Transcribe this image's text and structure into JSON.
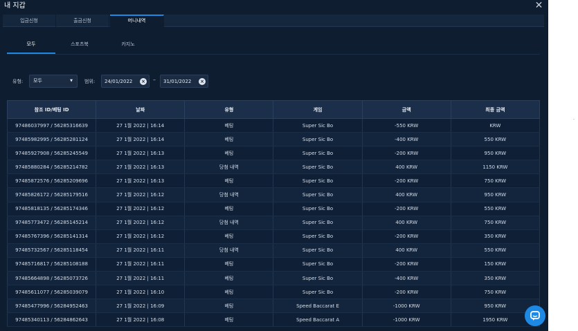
{
  "window": {
    "title": "내 지갑"
  },
  "tabs": [
    "입금신청",
    "출금신청",
    "머니내역"
  ],
  "subtabs": [
    "모두",
    "스포츠북",
    "카지노"
  ],
  "filters": {
    "type_label": "유형:",
    "type_value": "모두",
    "range_label": "범위:",
    "date_from": "24/01/2022",
    "date_to": "31/01/2022",
    "separator": "–"
  },
  "table": {
    "columns": [
      "참조 ID/베팅 ID",
      "날짜",
      "유형",
      "게임",
      "금액",
      "최종 금액"
    ],
    "rows": [
      [
        "97486037997 / 56285316639",
        "27 1월 2022 | 16:14",
        "베팅",
        "Super Sic Bo",
        "-550 KRW",
        "KRW"
      ],
      [
        "97485982995 / 56285281124",
        "27 1월 2022 | 16:14",
        "베팅",
        "Super Sic Bo",
        "-400 KRW",
        "550 KRW"
      ],
      [
        "97485927908 / 56285245549",
        "27 1월 2022 | 16:13",
        "베팅",
        "Super Sic Bo",
        "-200 KRW",
        "950 KRW"
      ],
      [
        "97485880284 / 56285214782",
        "27 1월 2022 | 16:13",
        "당첨 내역",
        "Super Sic Bo",
        "400 KRW",
        "1150 KRW"
      ],
      [
        "97485872576 / 56285209696",
        "27 1월 2022 | 16:13",
        "베팅",
        "Super Sic Bo",
        "-200 KRW",
        "750 KRW"
      ],
      [
        "97485826172 / 56285179516",
        "27 1월 2022 | 16:12",
        "당첨 내역",
        "Super Sic Bo",
        "400 KRW",
        "950 KRW"
      ],
      [
        "97485818135 / 56285174346",
        "27 1월 2022 | 16:12",
        "베팅",
        "Super Sic Bo",
        "-200 KRW",
        "550 KRW"
      ],
      [
        "97485773472 / 56285145214",
        "27 1월 2022 | 16:12",
        "당첨 내역",
        "Super Sic Bo",
        "400 KRW",
        "750 KRW"
      ],
      [
        "97485767396 / 56285141314",
        "27 1월 2022 | 16:12",
        "베팅",
        "Super Sic Bo",
        "-200 KRW",
        "350 KRW"
      ],
      [
        "97485732567 / 56285118454",
        "27 1월 2022 | 16:11",
        "당첨 내역",
        "Super Sic Bo",
        "400 KRW",
        "550 KRW"
      ],
      [
        "97485716817 / 56285108188",
        "27 1월 2022 | 16:11",
        "베팅",
        "Super Sic Bo",
        "-200 KRW",
        "150 KRW"
      ],
      [
        "97485664898 / 56285073726",
        "27 1월 2022 | 16:11",
        "베팅",
        "Super Sic Bo",
        "-400 KRW",
        "350 KRW"
      ],
      [
        "97485611077 / 56285039079",
        "27 1월 2022 | 16:10",
        "베팅",
        "Super Sic Bo",
        "-200 KRW",
        "750 KRW"
      ],
      [
        "97485477996 / 56284952463",
        "27 1월 2022 | 16:09",
        "베팅",
        "Speed Baccarat E",
        "-1000 KRW",
        "950 KRW"
      ],
      [
        "97485340113 / 56284862643",
        "27 1월 2022 | 16:08",
        "베팅",
        "Speed Baccarat A",
        "-1000 KRW",
        "1950 KRW"
      ]
    ]
  },
  "icons": {
    "close": "close-icon",
    "caret": "caret-down-icon",
    "clear": "clear-icon",
    "chat": "chat-icon"
  },
  "colors": {
    "background": "#0e1d30",
    "accent": "#1e88e5",
    "header": "#1b2f4b"
  },
  "edge_text": "·"
}
